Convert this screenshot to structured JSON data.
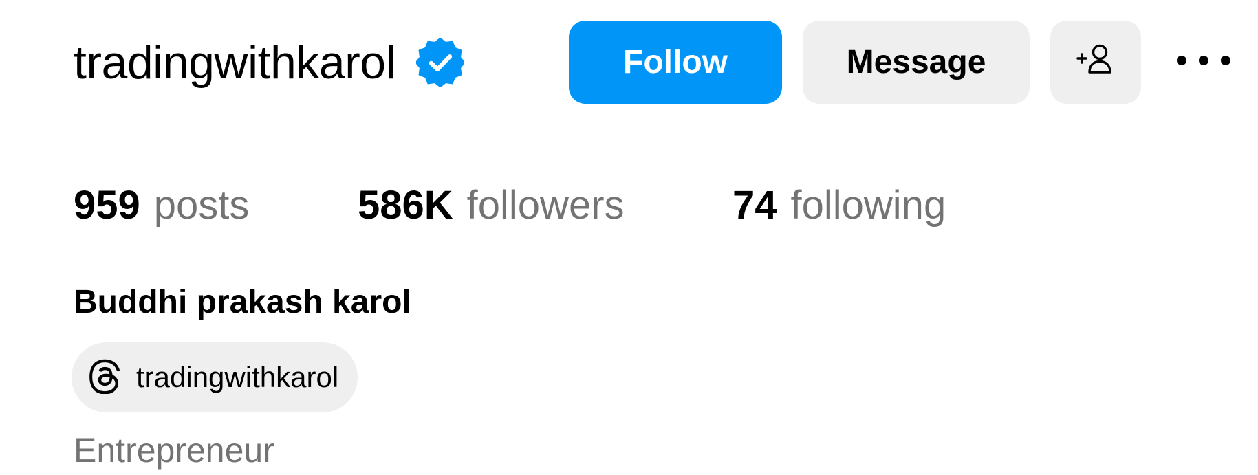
{
  "profile": {
    "username": "tradingwithkarol",
    "verified_icon": "verified-badge-icon",
    "full_name": "Buddhi prakash karol",
    "category": "Entrepreneur"
  },
  "actions": {
    "follow_label": "Follow",
    "message_label": "Message",
    "add_user_icon": "add-user-icon",
    "more_icon": "more-options-icon"
  },
  "stats": {
    "posts_count": "959",
    "posts_label": "posts",
    "followers_count": "586K",
    "followers_label": "followers",
    "following_count": "74",
    "following_label": "following"
  },
  "threads": {
    "icon": "threads-icon",
    "handle": "tradingwithkarol"
  },
  "colors": {
    "accent": "#0095f6",
    "button_secondary": "#efefef",
    "muted_text": "#737373"
  }
}
